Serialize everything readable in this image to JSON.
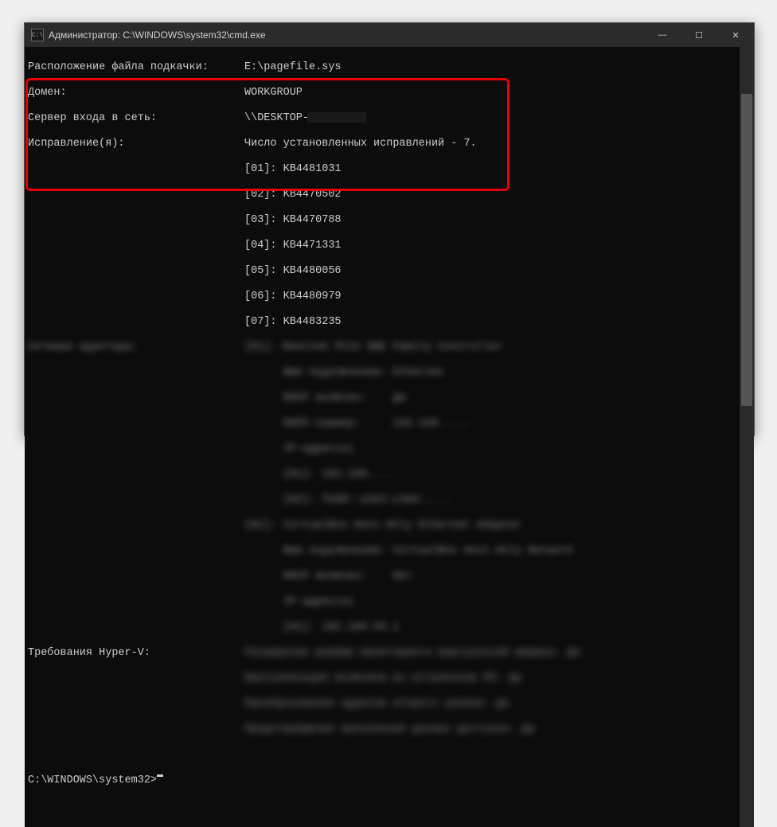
{
  "titlebar": {
    "icon_text": "C:\\",
    "title": "Администратор: C:\\WINDOWS\\system32\\cmd.exe",
    "min": "—",
    "max": "☐",
    "close": "✕"
  },
  "lines": {
    "pagefile_label": "Расположение файла подкачки:",
    "pagefile_value": "E:\\pagefile.sys",
    "domain_label": "Домен:",
    "domain_value": "WORKGROUP",
    "logon_label": "Сервер входа в сеть:",
    "logon_value": "\\\\DESKTOP-",
    "fixes_label": "Исправление(я):",
    "fixes_header": "Число установленных исправлений - 7.",
    "fixes": [
      "[01]: KB4481031",
      "[02]: KB4470502",
      "[03]: KB4470788",
      "[04]: KB4471331",
      "[05]: KB4480056",
      "[06]: KB4480979",
      "[07]: KB4483235"
    ],
    "adapters_label": "Сетевые адаптеры:",
    "hyperv_label": "Требования Hyper-V:",
    "prompt": "C:\\WINDOWS\\system32>"
  },
  "blur_blocks": [
    "[01]: Realtek PCIe GBE Family Controller",
    "      Имя подключения: Ethernet",
    "      DHCP включен:    Да",
    "      DHCP-сервер:     192.168.....",
    "      IP-адрес(а)",
    "      [01]: 192.168....",
    "      [02]: fe80::a1b2:c3d4:....",
    "[02]: VirtualBox Host-Only Ethernet Adapter",
    "      Имя подключения: VirtualBox Host-Only Network",
    "      DHCP включен:    Нет",
    "      IP-адрес(а)",
    "      [01]: 192.168.56.1"
  ],
  "blur_hyperv": [
    "Расширения режима мониторинга виртуальной машины: Да",
    "Виртуализация включена во встроенном ПО: Да",
    "Преобразование адресов второго уровня: Да",
    "Предотвращение выполнения данных доступно: Да"
  ]
}
